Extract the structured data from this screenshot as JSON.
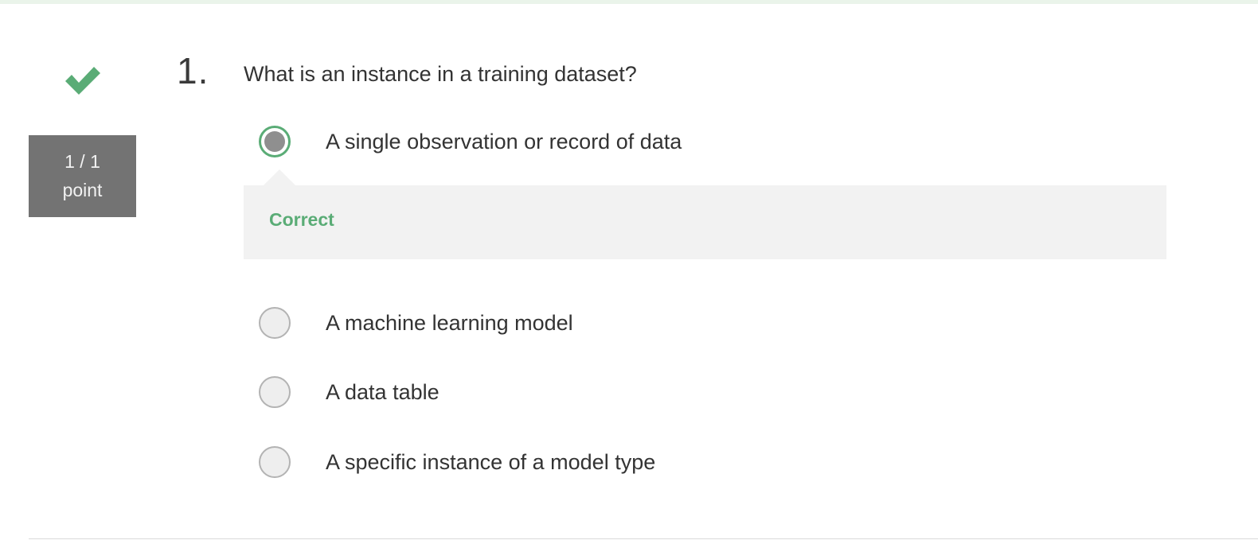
{
  "question": {
    "number": "1.",
    "text": "What is an instance in a training dataset?",
    "score_value": "1 / 1",
    "score_unit": "point",
    "status_icon": "check-icon",
    "feedback": "Correct"
  },
  "options": [
    {
      "label": "A single observation or record of data",
      "selected": true
    },
    {
      "label": "A machine learning model",
      "selected": false
    },
    {
      "label": "A data table",
      "selected": false
    },
    {
      "label": "A specific instance of a model type",
      "selected": false
    }
  ],
  "colors": {
    "correct_green": "#5aac76",
    "badge_gray": "#737373",
    "feedback_bg": "#f2f2f2"
  }
}
